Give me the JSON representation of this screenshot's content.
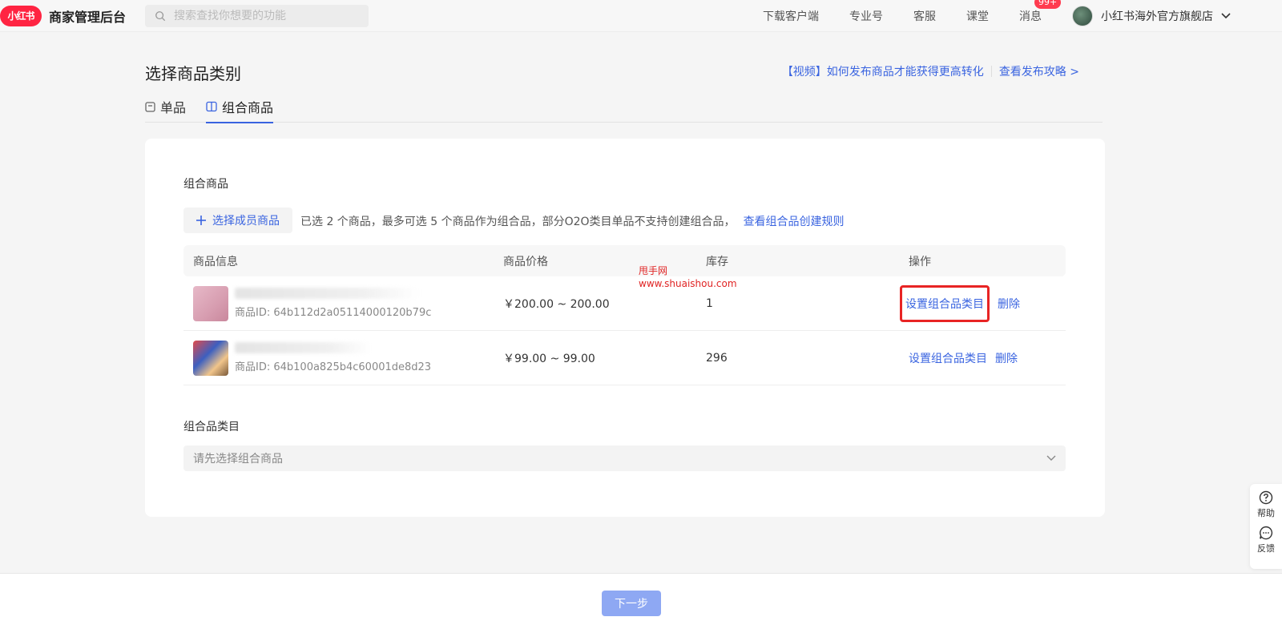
{
  "topbar": {
    "logo": "小红书",
    "brand": "商家管理后台",
    "search_placeholder": "搜索查找你想要的功能",
    "nav": [
      "下载客户端",
      "专业号",
      "客服",
      "课堂",
      "消息"
    ],
    "badge": "99+",
    "store_name": "小红书海外官方旗舰店"
  },
  "page": {
    "title": "选择商品类别",
    "video_link": "【视频】如何发布商品才能获得更高转化",
    "guide_link": "查看发布攻略 >",
    "tabs": [
      "单品",
      "组合商品"
    ],
    "active_tab": "组合商品"
  },
  "combo": {
    "section_title": "组合商品",
    "choose_button": "选择成员商品",
    "hint": "已选 2 个商品，最多可选 5 个商品作为组合品，部分O2O类目单品不支持创建组合品，",
    "hint_link": "查看组合品创建规则",
    "columns": [
      "商品信息",
      "商品价格",
      "库存",
      "操作"
    ],
    "rows": [
      {
        "id": "商品ID: 64b112d2a05114000120b79c",
        "price": "￥200.00 ~ 200.00",
        "stock": "1",
        "op_set": "设置组合品类目",
        "op_delete": "删除"
      },
      {
        "id": "商品ID: 64b100a825b4c60001de8d23",
        "price": "￥99.00 ~ 99.00",
        "stock": "296",
        "op_set": "设置组合品类目",
        "op_delete": "删除"
      }
    ]
  },
  "category": {
    "section_title": "组合品类目",
    "placeholder": "请先选择组合商品"
  },
  "watermark": {
    "line1": "甩手网",
    "line2": "www.shuaishou.com"
  },
  "float_help": {
    "help": "帮助",
    "feedback": "反馈"
  },
  "footer": {
    "next_button": "下一步"
  },
  "colors": {
    "brand_red": "#ff2442",
    "link_blue": "#3a64e0",
    "highlight_red": "#e82424",
    "next_button": "#8ea8f3"
  }
}
